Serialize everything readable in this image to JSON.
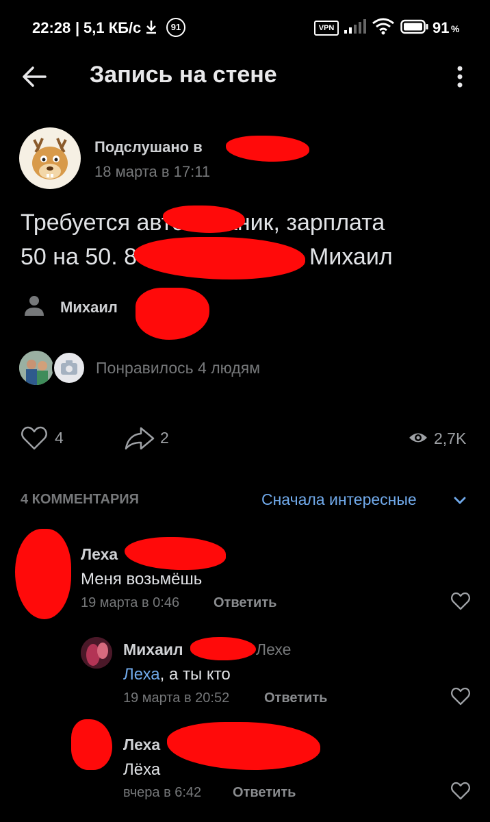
{
  "status_bar": {
    "time": "22:28",
    "speed": "5,1 КБ/с",
    "notif_count": "91",
    "vpn": "VPN",
    "battery": "91",
    "battery_pct_sign": "%"
  },
  "header": {
    "title": "Запись на стене"
  },
  "post": {
    "author": "Подслушано в",
    "date": "18 марта в 17:11",
    "text_line1": "Требуется автомеханик, зарплата",
    "text_line2_start": "50 на 50. 8",
    "text_line2_end": "Михаил",
    "signer": "Михаил",
    "likes_text": "Понравилось 4 людям",
    "like_count": "4",
    "share_count": "2",
    "views": "2,7K"
  },
  "comments_header": {
    "count_label": "4 КОММЕНТАРИЯ",
    "sort_label": "Сначала интересные"
  },
  "comments": [
    {
      "author": "Леха",
      "text": "Меня возьмёшь",
      "date": "19 марта в 0:46",
      "reply": "Ответить"
    },
    {
      "author": "Михаил",
      "reply_to": "Лехе",
      "mention": "Леха",
      "text": ", а ты кто",
      "date": "19 марта в 20:52",
      "reply": "Ответить"
    },
    {
      "author": "Леха",
      "text": "Лёха",
      "date": "вчера в 6:42",
      "reply": "Ответить"
    }
  ]
}
